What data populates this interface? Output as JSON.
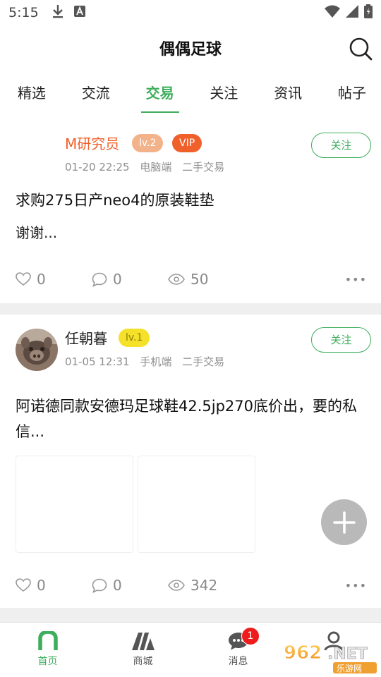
{
  "status_bar": {
    "time": "5:15",
    "left_icons": [
      "download-icon",
      "a-icon"
    ],
    "right_icons": [
      "wifi-icon",
      "signal-icon",
      "battery-icon"
    ]
  },
  "header": {
    "title": "偶偶足球",
    "search_icon": "search-icon"
  },
  "tabs": [
    {
      "label": "精选",
      "active": false
    },
    {
      "label": "交流",
      "active": false
    },
    {
      "label": "交易",
      "active": true
    },
    {
      "label": "关注",
      "active": false
    },
    {
      "label": "资讯",
      "active": false
    },
    {
      "label": "帖子",
      "active": false
    }
  ],
  "posts": [
    {
      "username": "M研究员",
      "badges": [
        "lv.2",
        "VIP"
      ],
      "time": "01-20 22:25",
      "device": "电脑端",
      "category": "二手交易",
      "follow_label": "关注",
      "title": "求购275日产neo4的原装鞋垫",
      "excerpt": "谢谢...",
      "likes": "0",
      "comments": "0",
      "views": "50",
      "more": "•••"
    },
    {
      "username": "任朝暮",
      "badges": [
        "lv.1"
      ],
      "time": "01-05 12:31",
      "device": "手机端",
      "category": "二手交易",
      "follow_label": "关注",
      "title": "阿诺德同款安德玛足球鞋42.5jp270底价出，要的私信...",
      "likes": "0",
      "comments": "0",
      "views": "342",
      "more": "•••"
    }
  ],
  "fab_icon": "plus-icon",
  "bottom_nav": [
    {
      "label": "首页",
      "icon": "home-icon",
      "active": true
    },
    {
      "label": "商城",
      "icon": "mall-icon",
      "active": false
    },
    {
      "label": "消息",
      "icon": "message-icon",
      "active": false,
      "badge": "1"
    },
    {
      "label": "",
      "icon": "profile-icon",
      "active": false
    }
  ],
  "watermark": "962.NET 乐游网",
  "colors": {
    "accent": "#3dae5c",
    "vip": "#f0602b",
    "badge_red": "#ee1c1c"
  }
}
